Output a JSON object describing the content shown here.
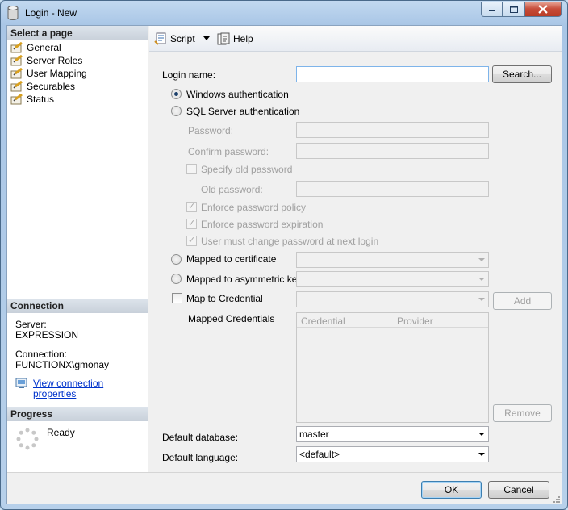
{
  "window": {
    "title": "Login - New"
  },
  "left": {
    "select_header": "Select a page",
    "pages": [
      "General",
      "Server Roles",
      "User Mapping",
      "Securables",
      "Status"
    ],
    "connection_header": "Connection",
    "server_label": "Server:",
    "server_value": "EXPRESSION",
    "connection_label": "Connection:",
    "connection_value": "FUNCTIONX\\gmonay",
    "view_link": "View connection properties",
    "progress_header": "Progress",
    "progress_status": "Ready"
  },
  "toolbar": {
    "script": "Script",
    "help": "Help"
  },
  "form": {
    "login_name_label": "Login name:",
    "login_name_value": "",
    "search_button": "Search...",
    "windows_auth": "Windows authentication",
    "sql_auth": "SQL Server authentication",
    "password_label": "Password:",
    "confirm_label": "Confirm password:",
    "specify_old": "Specify old password",
    "old_password_label": "Old password:",
    "enforce_policy": "Enforce password policy",
    "enforce_expiration": "Enforce password expiration",
    "must_change": "User must change password at next login",
    "mapped_cert": "Mapped to certificate",
    "mapped_asym": "Mapped to asymmetric key",
    "map_credential": "Map to Credential",
    "add_button": "Add",
    "mapped_credentials_label": "Mapped Credentials",
    "cred_columns": [
      "Credential",
      "Provider"
    ],
    "remove_button": "Remove",
    "default_db_label": "Default database:",
    "default_db_value": "master",
    "default_lang_label": "Default language:",
    "default_lang_value": "<default>"
  },
  "buttons": {
    "ok": "OK",
    "cancel": "Cancel"
  }
}
